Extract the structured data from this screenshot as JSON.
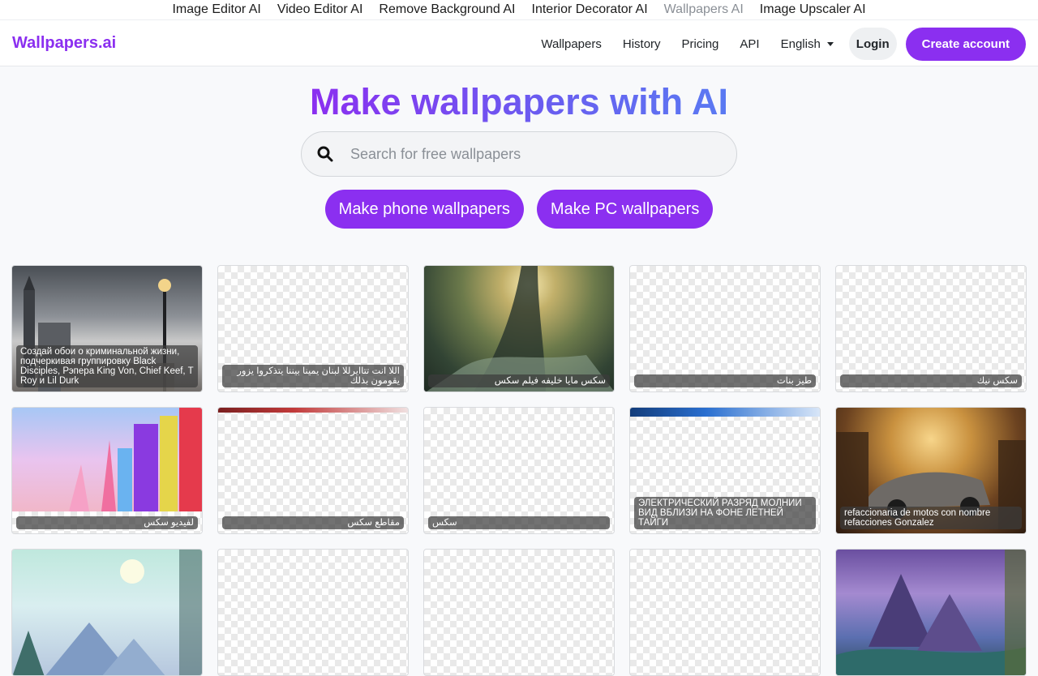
{
  "topstrip": {
    "items": [
      {
        "label": "Image Editor AI"
      },
      {
        "label": "Video Editor AI"
      },
      {
        "label": "Remove Background AI"
      },
      {
        "label": "Interior Decorator AI"
      },
      {
        "label": "Wallpapers AI"
      },
      {
        "label": "Image Upscaler AI"
      }
    ]
  },
  "nav": {
    "brand": "Wallpapers.ai",
    "links": [
      {
        "label": "Wallpapers"
      },
      {
        "label": "History"
      },
      {
        "label": "Pricing"
      },
      {
        "label": "API"
      }
    ],
    "language": "English",
    "login": "Login",
    "create_account": "Create account"
  },
  "hero": {
    "title": "Make wallpapers with AI",
    "search_placeholder": "Search for free wallpapers",
    "phone_button": "Make phone wallpapers",
    "pc_button": "Make PC wallpapers"
  },
  "colors": {
    "accent": "#8b2ff0"
  },
  "cards": [
    {
      "caption": "Создай обои о криминальной жизни, подчеркивая группировку Black Disciples, Рэпера King Von, Chief Keef, T Roy и Lil Durk"
    },
    {
      "caption": "اللا انت تتاايرللا لبنان يمينا بيننا يتذكروا يزور يقومون بذلك"
    },
    {
      "caption": "سكس مايا خليفه فيلم سكس"
    },
    {
      "caption": "طيز بنات"
    },
    {
      "caption": "سكس نيك"
    },
    {
      "caption": "لفيديو سكس"
    },
    {
      "caption": "مقاطع سكس"
    },
    {
      "caption": "سكس"
    },
    {
      "caption": "ЭЛЕКТРИЧЕСКИЙ РАЗРЯД МОЛНИИ ВИД ВБЛИЗИ НА ФОНЕ ЛЕТНЕЙ ТАЙГИ"
    },
    {
      "caption": "refaccionaria de motos con nombre refacciones Gonzalez"
    },
    {
      "caption": ""
    },
    {
      "caption": ""
    },
    {
      "caption": ""
    },
    {
      "caption": ""
    },
    {
      "caption": ""
    }
  ]
}
